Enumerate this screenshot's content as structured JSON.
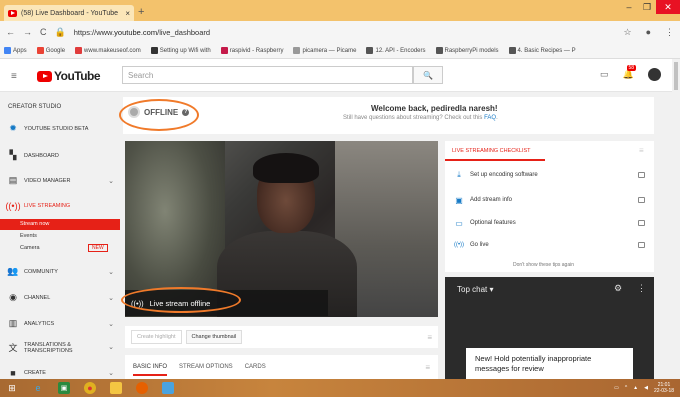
{
  "browser": {
    "tab_title": "(58) Live Dashboard - YouTube",
    "tab_close": "×",
    "new_tab": "+",
    "url_prefix": "https://www.",
    "url_domain": "youtube.com",
    "url_path": "/live_dashboard",
    "bookmarks": [
      {
        "label": "Apps",
        "color": "#4285f4"
      },
      {
        "label": "Google",
        "color": "#ea4335"
      },
      {
        "label": "www.makeuseof.com",
        "color": "#e03c3c"
      },
      {
        "label": "Setting up Wifi with",
        "color": "#333333"
      },
      {
        "label": "raspivid - Raspberry",
        "color": "#c51a4a"
      },
      {
        "label": "picamera — Picame",
        "color": "#999999"
      },
      {
        "label": "12. API - Encoders",
        "color": "#555555"
      },
      {
        "label": "RaspberryPi models",
        "color": "#555555"
      },
      {
        "label": "4. Basic Recipes — P",
        "color": "#555555"
      }
    ]
  },
  "youtube": {
    "logo_text": "YouTube",
    "search_placeholder": "Search",
    "notif_count": "58"
  },
  "sidebar": {
    "creator_studio": "CREATOR STUDIO",
    "studio_beta": "YOUTUBE STUDIO BETA",
    "items": [
      {
        "label": "DASHBOARD",
        "icon": "dashboard-icon"
      },
      {
        "label": "VIDEO MANAGER",
        "icon": "video-manager-icon"
      },
      {
        "label": "LIVE STREAMING",
        "icon": "live-icon"
      },
      {
        "label": "COMMUNITY",
        "icon": "community-icon"
      },
      {
        "label": "CHANNEL",
        "icon": "channel-icon"
      },
      {
        "label": "ANALYTICS",
        "icon": "analytics-icon"
      },
      {
        "label": "TRANSLATIONS & TRANSCRIPTIONS",
        "icon": "translate-icon"
      },
      {
        "label": "CREATE",
        "icon": "create-icon"
      }
    ],
    "sub_stream_now": "Stream now",
    "sub_events": "Events",
    "sub_camera": "Camera",
    "new_badge": "NEW"
  },
  "dashboard": {
    "status": "OFFLINE",
    "welcome_title": "Welcome back, pediredla naresh!",
    "welcome_sub": "Still have questions about streaming? Check out this ",
    "faq_link": "FAQ",
    "stream_status": "Live stream offline",
    "create_highlight": "Create highlight",
    "change_thumbnail": "Change thumbnail",
    "tabs": [
      "BASIC INFO",
      "STREAM OPTIONS",
      "CARDS"
    ]
  },
  "checklist": {
    "title": "LIVE STREAMING CHECKLIST",
    "items": [
      "Set up encoding software",
      "Add stream info",
      "Optional features",
      "Go live"
    ],
    "dont_show": "Don't show these tips again"
  },
  "chat": {
    "header": "Top chat ▾",
    "tip": "New! Hold potentially inappropriate messages for review"
  },
  "taskbar": {
    "time": "21:01",
    "date": "22-03-18"
  }
}
